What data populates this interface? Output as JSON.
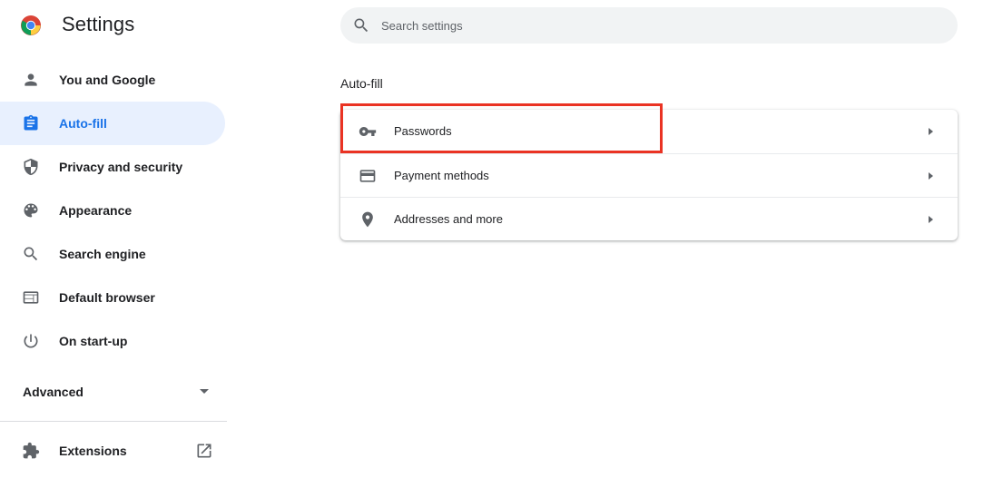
{
  "header": {
    "title": "Settings",
    "logo_icon": "chrome-logo-icon"
  },
  "search": {
    "placeholder": "Search settings",
    "value": "",
    "icon": "search-icon"
  },
  "sidebar": {
    "items": [
      {
        "label": "You and Google",
        "icon": "person-icon",
        "active": false
      },
      {
        "label": "Auto-fill",
        "icon": "clipboard-icon",
        "active": true
      },
      {
        "label": "Privacy and security",
        "icon": "shield-icon",
        "active": false
      },
      {
        "label": "Appearance",
        "icon": "palette-icon",
        "active": false
      },
      {
        "label": "Search engine",
        "icon": "search-icon",
        "active": false
      },
      {
        "label": "Default browser",
        "icon": "browser-window-icon",
        "active": false
      },
      {
        "label": "On start-up",
        "icon": "power-icon",
        "active": false
      }
    ],
    "advanced_label": "Advanced",
    "extensions_label": "Extensions"
  },
  "main": {
    "section_title": "Auto-fill",
    "rows": [
      {
        "label": "Passwords",
        "icon": "key-icon"
      },
      {
        "label": "Payment methods",
        "icon": "credit-card-icon"
      },
      {
        "label": "Addresses and more",
        "icon": "location-pin-icon"
      }
    ]
  },
  "colors": {
    "accent": "#1a73e8",
    "active_bg": "#e8f0fe",
    "highlight_border": "#ea3323",
    "icon_gray": "#5f6368"
  }
}
